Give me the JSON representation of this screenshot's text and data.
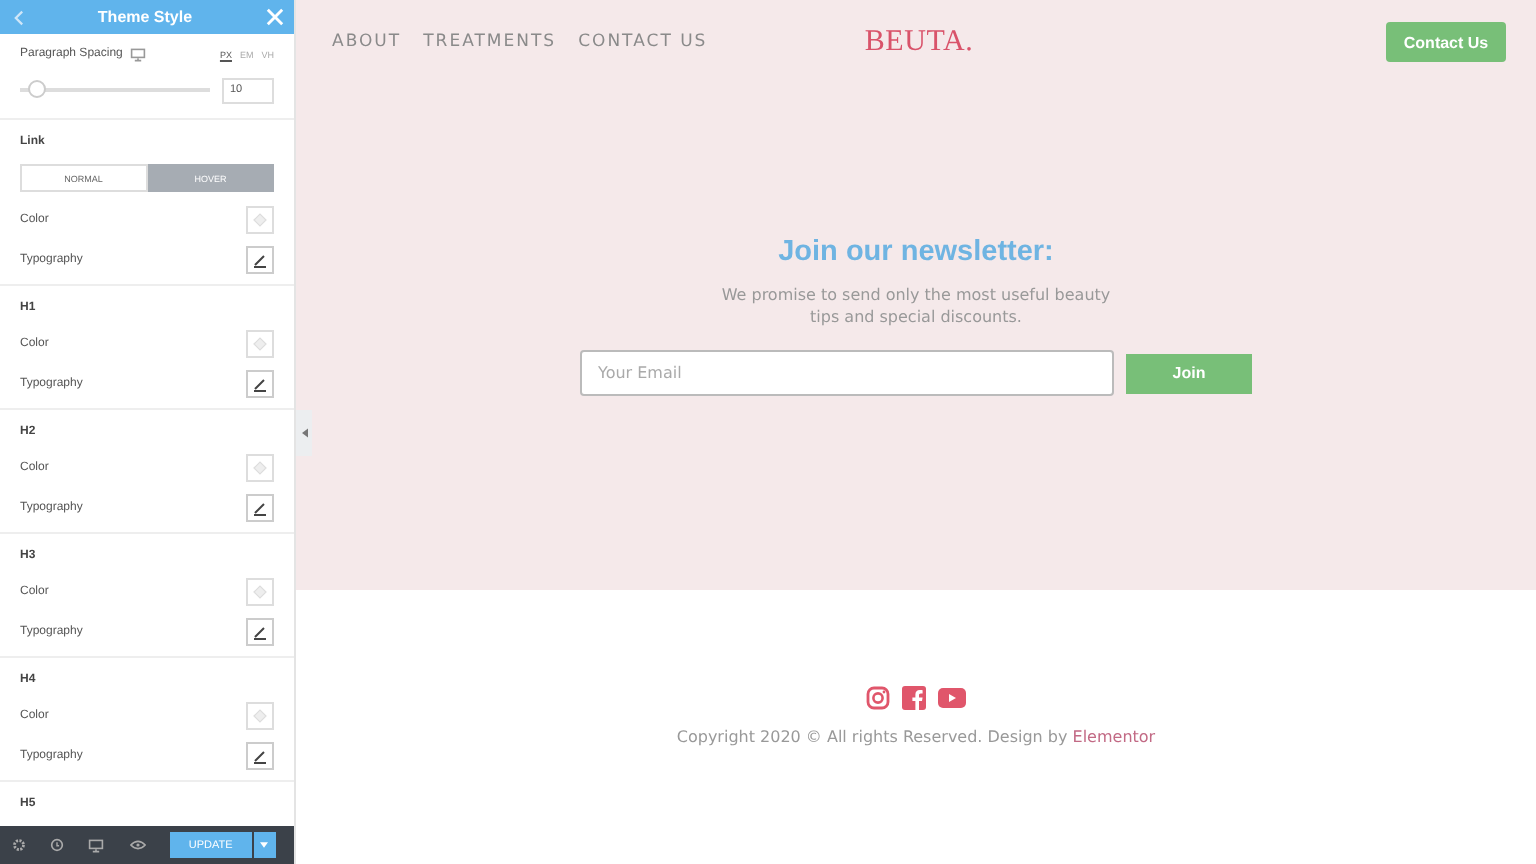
{
  "panel": {
    "title": "Theme Style",
    "spacing": {
      "label": "Paragraph Spacing",
      "units": [
        {
          "label": "PX",
          "selected": true
        },
        {
          "label": "EM",
          "selected": false
        },
        {
          "label": "VH",
          "selected": false
        }
      ],
      "level": 0.09,
      "value": "10"
    },
    "groups": [
      {
        "title": "Link",
        "tabs": [
          {
            "label": "NORMAL",
            "selected": false
          },
          {
            "label": "HOVER",
            "selected": true
          }
        ],
        "rows": [
          {
            "label": "Color",
            "kind": "color"
          },
          {
            "label": "Typography",
            "kind": "typography"
          }
        ]
      },
      {
        "title": "H1",
        "rows": [
          {
            "label": "Color",
            "kind": "color"
          },
          {
            "label": "Typography",
            "kind": "typography"
          }
        ]
      },
      {
        "title": "H2",
        "rows": [
          {
            "label": "Color",
            "kind": "color"
          },
          {
            "label": "Typography",
            "kind": "typography"
          }
        ]
      },
      {
        "title": "H3",
        "rows": [
          {
            "label": "Color",
            "kind": "color"
          },
          {
            "label": "Typography",
            "kind": "typography"
          }
        ]
      },
      {
        "title": "H4",
        "rows": [
          {
            "label": "Color",
            "kind": "color"
          },
          {
            "label": "Typography",
            "kind": "typography"
          }
        ]
      },
      {
        "title": "H5"
      }
    ],
    "update": "UPDATE"
  },
  "nav": {
    "links": [
      "ABOUT",
      "TREATMENTS",
      "CONTACT US"
    ],
    "logo": "BEUTA.",
    "cta": "Contact Us"
  },
  "newsletter": {
    "title": "Join our newsletter:",
    "text": "We promise to send only the most useful beauty tips and special discounts.",
    "placeholder": "Your Email",
    "button": "Join"
  },
  "footer": {
    "copyright": "Copyright 2020 © All rights Reserved. Design by",
    "link": "Elementor"
  }
}
